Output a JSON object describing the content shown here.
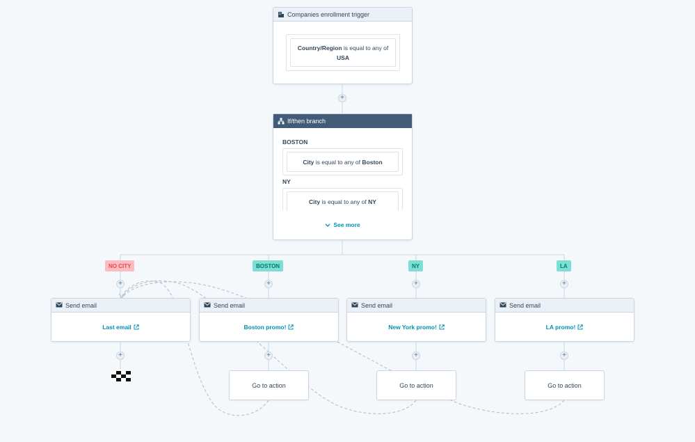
{
  "colors": {
    "background": "#f5f8fa",
    "line": "#cbd6e2",
    "branch_header": "#425b76",
    "link": "#0091ae",
    "tag_red": "#f2545b",
    "tag_teal": "#00bda5"
  },
  "trigger": {
    "title": "Companies enrollment trigger",
    "icon": "building-icon",
    "field": "Country/Region",
    "operator": "is equal to any of",
    "value": "USA"
  },
  "branch": {
    "title": "If/then branch",
    "icon": "branch-icon",
    "conditions": [
      {
        "name": "BOSTON",
        "field": "City",
        "operator": "is equal to any of",
        "value": "Boston"
      },
      {
        "name": "NY",
        "field": "City",
        "operator": "is equal to any of",
        "value": "NY"
      }
    ],
    "see_more": "See more"
  },
  "tags": [
    "NO CITY",
    "BOSTON",
    "NY",
    "LA"
  ],
  "emails": [
    {
      "title": "Send email",
      "link": "Last email"
    },
    {
      "title": "Send email",
      "link": "Boston promo!"
    },
    {
      "title": "Send email",
      "link": "New York promo!"
    },
    {
      "title": "Send email",
      "link": "LA promo!"
    }
  ],
  "goto": [
    "Go to action",
    "Go to action",
    "Go to action"
  ],
  "plus_symbol": "+"
}
